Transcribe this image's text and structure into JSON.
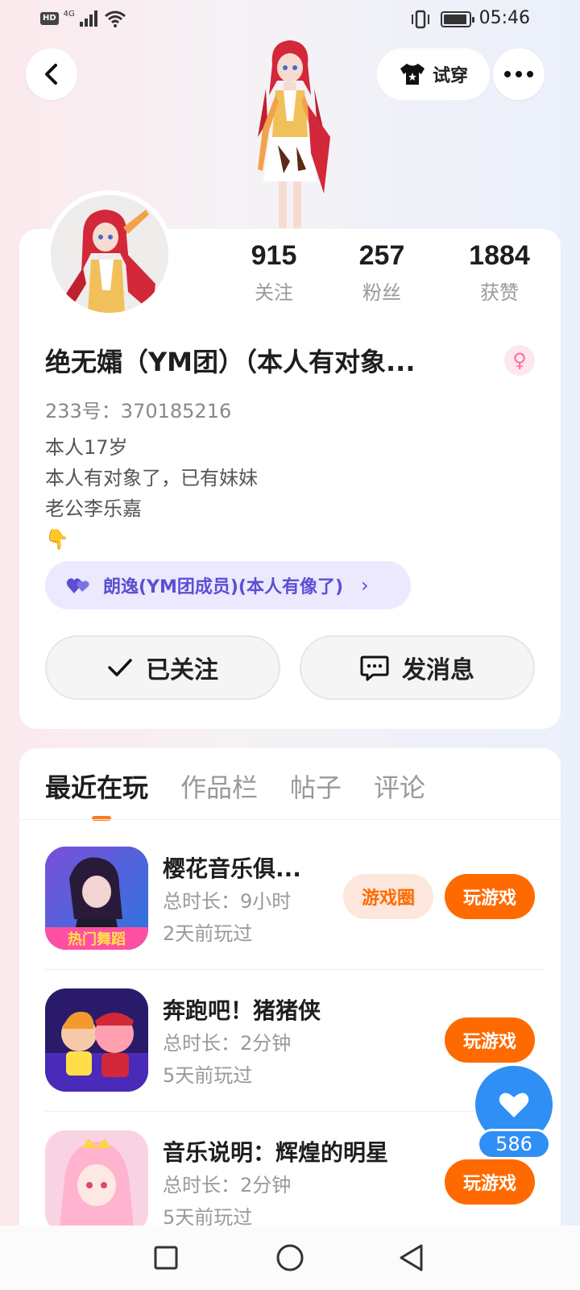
{
  "status_bar": {
    "hd": "HD",
    "network": "4G",
    "time": "05:46"
  },
  "header": {
    "try_on_label": "试穿",
    "icons": [
      "back-arrow-icon",
      "tshirt-icon",
      "more-dots-icon"
    ]
  },
  "profile": {
    "stats": [
      {
        "value": "915",
        "label": "关注"
      },
      {
        "value": "257",
        "label": "粉丝"
      },
      {
        "value": "1884",
        "label": "获赞"
      }
    ],
    "nickname": "绝无孀（YM团）（本人有对象...",
    "gender_icon": "female-icon",
    "id_line": "233号：370185216",
    "bio": [
      "本人17岁",
      "本人有对象了，已有妹妹",
      "老公李乐嘉",
      "👇"
    ],
    "group_pill": "朗逸(YM团成员)(本人有像了)",
    "follow_button": "已关注",
    "message_button": "发消息"
  },
  "tabs": [
    {
      "label": "最近在玩",
      "active": true
    },
    {
      "label": "作品栏",
      "active": false
    },
    {
      "label": "帖子",
      "active": false
    },
    {
      "label": "评论",
      "active": false
    }
  ],
  "games": [
    {
      "title": "樱花音乐俱...",
      "duration": "总时长：9小时",
      "last_played": "2天前玩过",
      "circle_btn": "游戏圈",
      "play_btn": "玩游戏",
      "icon_text": "热门舞蹈"
    },
    {
      "title": "奔跑吧！猪猪侠",
      "duration": "总时长：2分钟",
      "last_played": "5天前玩过",
      "play_btn": "玩游戏"
    },
    {
      "title": "音乐说明：辉煌的明星",
      "duration": "总时长：2分钟",
      "last_played": "5天前玩过",
      "play_btn": "玩游戏"
    }
  ],
  "like_float": {
    "count": "586"
  },
  "colors": {
    "accent": "#ff6a00",
    "like_blue": "#2f8ff5",
    "pill_purple": "#5b4fd3"
  }
}
